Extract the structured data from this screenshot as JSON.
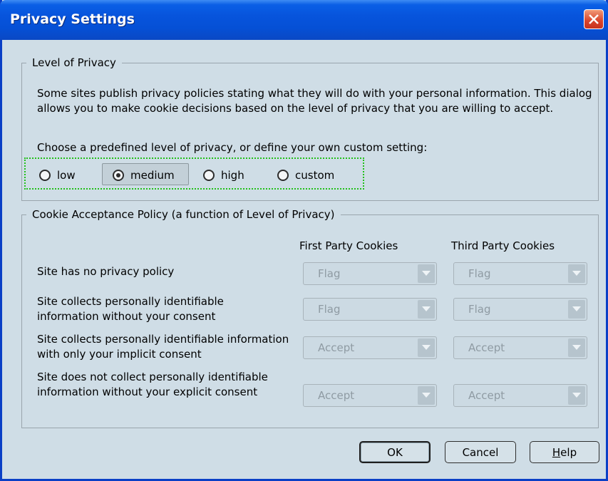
{
  "window": {
    "title": "Privacy Settings",
    "close_icon": "close-icon"
  },
  "level_group": {
    "legend": "Level of Privacy",
    "description": "Some sites publish privacy policies stating what they will do with your personal information. This dialog allows you to make cookie decisions based on the level of privacy that you are willing to accept.",
    "choose_text": "Choose a predefined level of privacy, or define your own custom setting:",
    "options": [
      {
        "label": "low",
        "selected": false
      },
      {
        "label": "medium",
        "selected": true
      },
      {
        "label": "high",
        "selected": false
      },
      {
        "label": "custom",
        "selected": false
      }
    ]
  },
  "cookie_group": {
    "legend": "Cookie Acceptance Policy (a function of Level of Privacy)",
    "columns": [
      "First Party Cookies",
      "Third Party Cookies"
    ],
    "rows": [
      {
        "label": "Site has no privacy policy",
        "first": "Flag",
        "third": "Flag"
      },
      {
        "label": "Site collects personally identifiable information without your consent",
        "first": "Flag",
        "third": "Flag"
      },
      {
        "label": "Site collects personally identifiable information with only your implicit consent",
        "first": "Accept",
        "third": "Accept"
      },
      {
        "label": "Site does not collect personally identifiable information without your explicit consent",
        "first": "Accept",
        "third": "Accept"
      }
    ]
  },
  "buttons": {
    "ok": "OK",
    "cancel": "Cancel",
    "help_mnemonic": "H",
    "help_rest": "elp"
  },
  "colors": {
    "title_bar": "#0754dc",
    "dialog_bg": "#cfdde6",
    "focus_outline": "#22c01a",
    "close_button": "#d9432a"
  }
}
